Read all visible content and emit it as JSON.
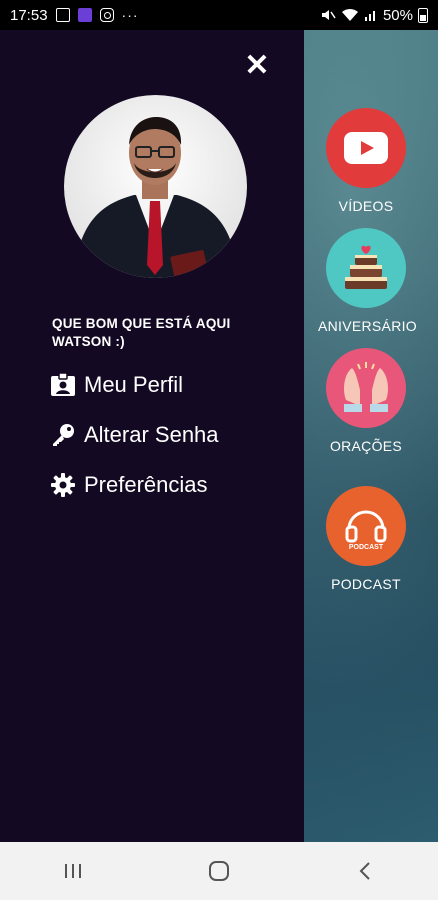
{
  "status_bar": {
    "time": "17:53",
    "battery": "50%",
    "more": "···"
  },
  "drawer": {
    "close_symbol": "✕",
    "greeting_line1": "QUE BOM QUE ESTÁ AQUI",
    "greeting_line2": "WATSON :)",
    "items": [
      {
        "label": "Meu Perfil",
        "icon": "id-badge-icon"
      },
      {
        "label": "Alterar Senha",
        "icon": "key-icon"
      },
      {
        "label": "Preferências",
        "icon": "gear-icon"
      }
    ]
  },
  "side_menu": {
    "items": [
      {
        "label": "VÍDEOS",
        "icon": "youtube-icon",
        "color": "#e23b3b"
      },
      {
        "label": "ANIVERSÁRIO",
        "icon": "cake-icon",
        "color": "#4fc7c3"
      },
      {
        "label": "ORAÇÕES",
        "icon": "praying-hands-icon",
        "color": "#e8577a"
      },
      {
        "label": "PODCAST",
        "icon": "headphones-icon",
        "color": "#e8622e",
        "badge": "PODCAST"
      }
    ]
  }
}
